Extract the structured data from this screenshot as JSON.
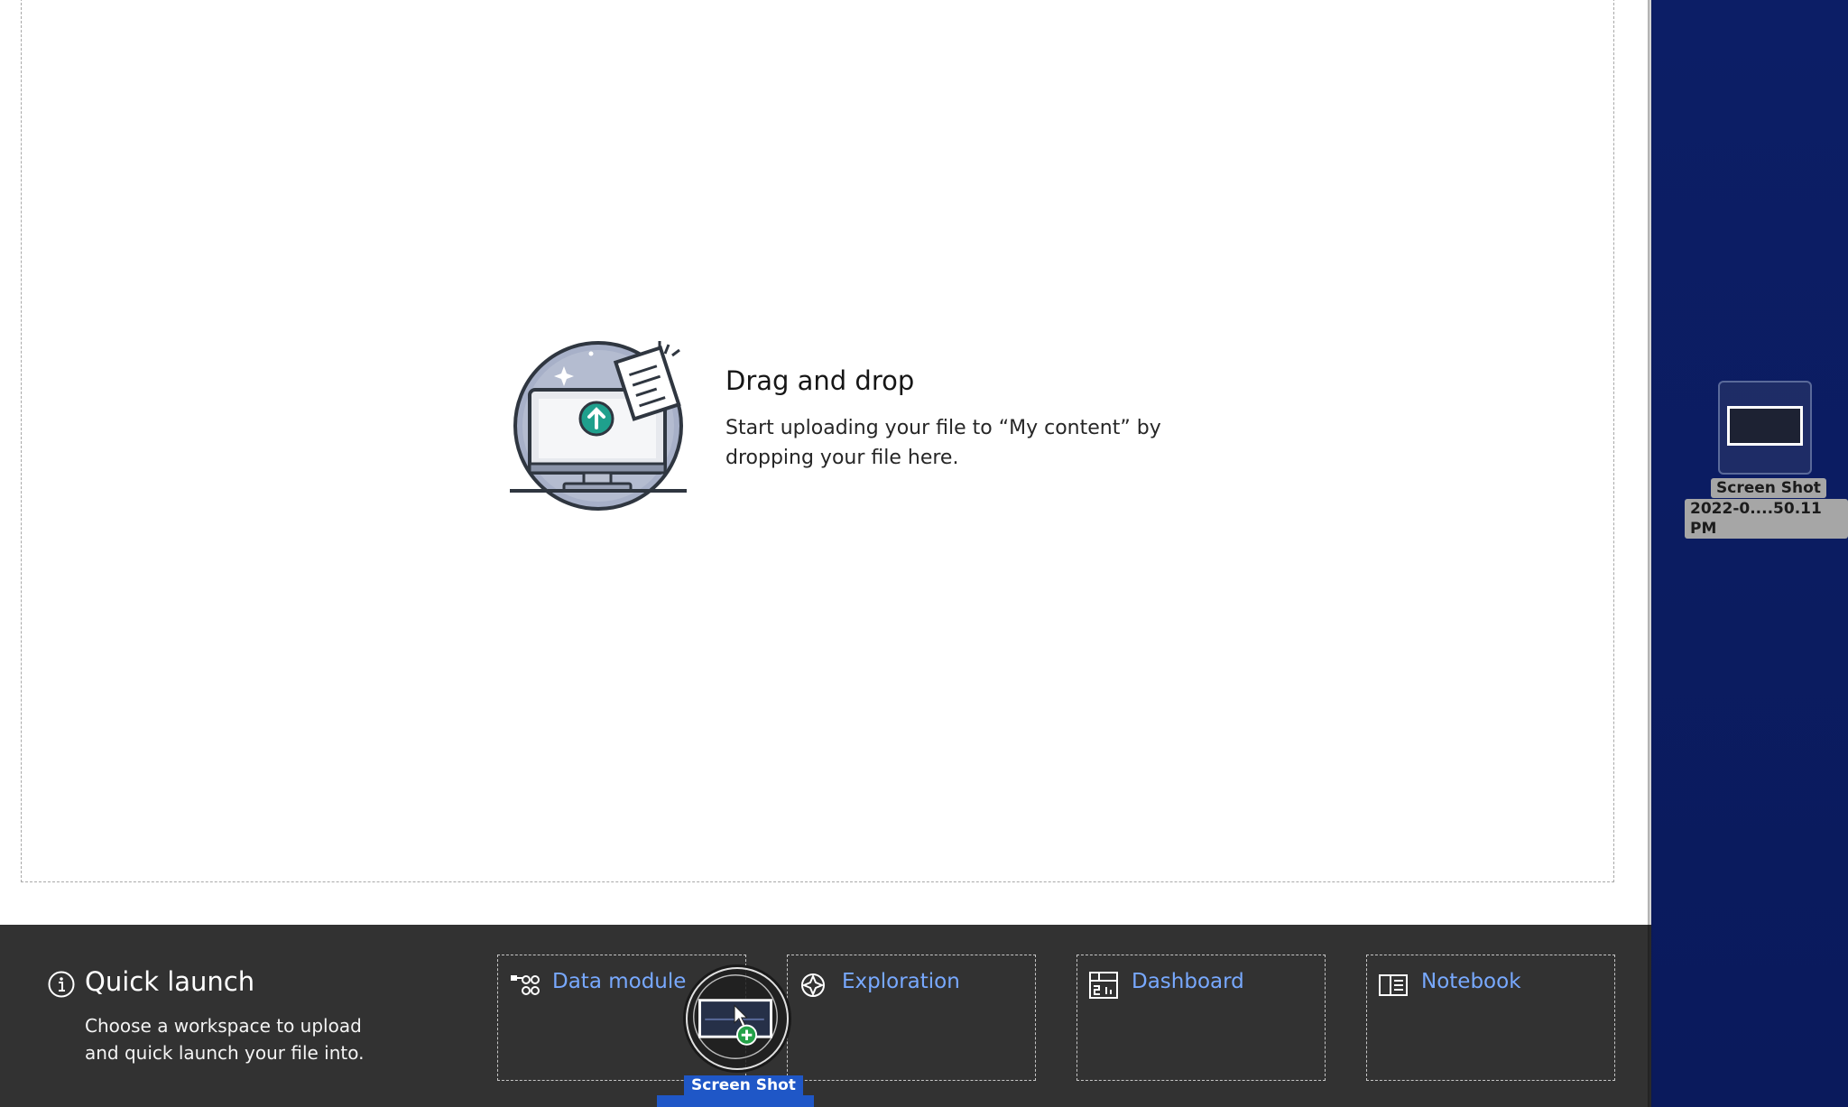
{
  "drop_zone": {
    "title": "Drag and drop",
    "description": "Start uploading your file to “My content” by dropping your file here."
  },
  "quick_launch": {
    "title": "Quick launch",
    "description": "Choose a workspace to upload and quick launch your file into.",
    "tiles": [
      {
        "label": "Data module",
        "icon": "data-module-icon"
      },
      {
        "label": "Exploration",
        "icon": "exploration-icon"
      },
      {
        "label": "Dashboard",
        "icon": "dashboard-icon"
      },
      {
        "label": "Notebook",
        "icon": "notebook-icon"
      }
    ]
  },
  "drag_ghost": {
    "label": "Screen Shot"
  },
  "desktop_file": {
    "name_line1": "Screen Shot",
    "name_line2": "2022-0....50.11 PM"
  },
  "colors": {
    "link_blue": "#78a9ff",
    "teal_accent": "#1fa08d",
    "quick_bar_bg": "#323232",
    "desktop_bg": "#0a1a5c"
  }
}
